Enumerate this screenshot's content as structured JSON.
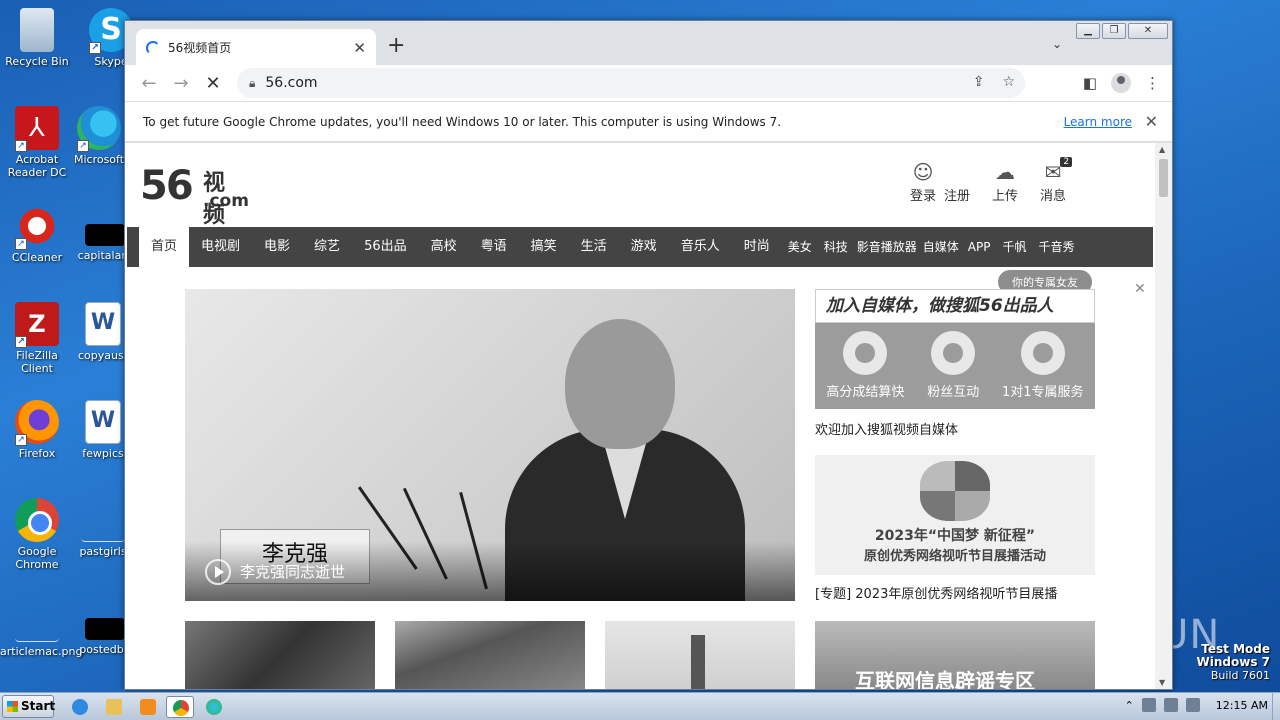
{
  "desktop": {
    "icons": [
      {
        "label": "Recycle Bin"
      },
      {
        "label": "Skype"
      },
      {
        "label": "Acrobat Reader DC"
      },
      {
        "label": "Microsoft"
      },
      {
        "label": "CCleaner"
      },
      {
        "label": "capitalaro"
      },
      {
        "label": "FileZilla Client"
      },
      {
        "label": "copyaust"
      },
      {
        "label": "Firefox"
      },
      {
        "label": "fewpics"
      },
      {
        "label": "Google Chrome"
      },
      {
        "label": "pastgirls"
      },
      {
        "label": "articlemac.png"
      },
      {
        "label": "postedbu"
      }
    ],
    "watermark": {
      "line1": "Test Mode",
      "line2": "Windows 7",
      "line3": "Build 7601"
    },
    "anyrun": "ANY.RUN"
  },
  "browser": {
    "tab_title": "56视频首页",
    "url": "56.com",
    "infobar_text": "To get future Google Chrome updates, you'll need Windows 10 or later. This computer is using Windows 7.",
    "infobar_link": "Learn more"
  },
  "site": {
    "logo": {
      "num": "56",
      "cn": "视频",
      "com": ".com"
    },
    "user_links": [
      {
        "label": "登录"
      },
      {
        "label": "注册"
      },
      {
        "label": "上传"
      },
      {
        "label": "消息",
        "badge": "2"
      }
    ],
    "nav": [
      "首页",
      "电视剧",
      "电影",
      "综艺",
      "56出品",
      "高校",
      "粤语",
      "搞笑",
      "生活",
      "游戏",
      "音乐人",
      "时尚",
      "美女",
      "科技",
      "影音播放器",
      "自媒体",
      "APP",
      "千帆",
      "千音秀"
    ],
    "tooltip": "你的专属女友",
    "hero": {
      "podium": "李克强",
      "caption": "李克强同志逝世"
    },
    "promo": {
      "title": "加入自媒体，做搜狐56出品人",
      "items": [
        "高分成结算快",
        "粉丝互动",
        "1对1专属服务"
      ],
      "text": "欢迎加入搜狐视频自媒体"
    },
    "side2": {
      "line1": "2023年“中国梦 新征程”",
      "line2": "原创优秀网络视听节目展播活动",
      "text": "[专题] 2023年原创优秀网络视听节目展播"
    },
    "thumb4_text": "互联网信息辟谣专区"
  },
  "taskbar": {
    "start": "Start",
    "clock": "12:15 AM"
  }
}
